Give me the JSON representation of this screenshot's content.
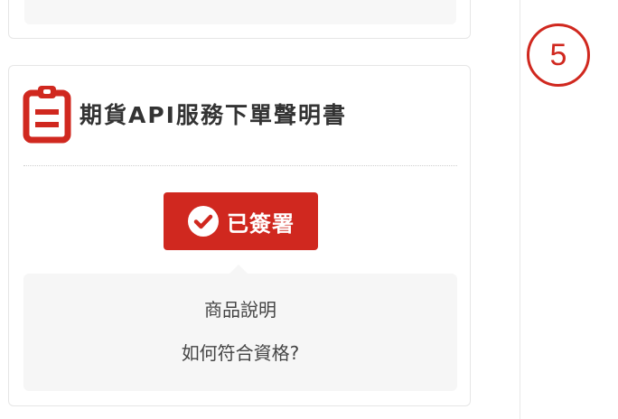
{
  "card": {
    "title": "期貨API服務下單聲明書",
    "icon": "clipboard-icon",
    "accent_color": "#d0281f"
  },
  "sign_button": {
    "label": "已簽署",
    "icon": "check-circle-icon",
    "status": "signed"
  },
  "info_panel": {
    "links": [
      {
        "label": "商品說明"
      },
      {
        "label": "如何符合資格?"
      }
    ]
  },
  "step": {
    "number": "5"
  }
}
